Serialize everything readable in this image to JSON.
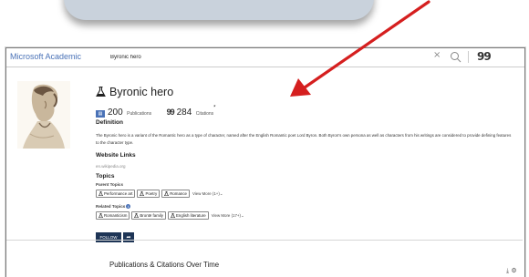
{
  "header": {
    "brand": "Microsoft Academic",
    "search_value": "Byronic hero",
    "clear_glyph": "×",
    "cite_glyph": "99"
  },
  "topic": {
    "title": "Byronic hero",
    "publications_count": "200",
    "publications_label": "Publications",
    "citations_count": "284",
    "citations_label": "Citations",
    "citations_marker": "*",
    "definition_heading": "Definition",
    "definition_text": "The Byronic hero is a variant of the Romantic hero as a type of character, named after the English Romantic poet Lord Byron. Both Byron's own persona as well as characters from his writings are considered to provide defining features to the character type.",
    "website_heading": "Website Links",
    "website_link": "en.wikipedia.org",
    "topics_heading": "Topics",
    "parent_topics_label": "Parent Topics",
    "parent_topics": [
      "Performance art",
      "Poetry",
      "Romance"
    ],
    "parent_view_more": "View More (1+)",
    "related_topics_label": "Related Topics",
    "related_topics": [
      "Romanticism",
      "Brontë family",
      "English literature"
    ],
    "related_view_more": "View More (17+)",
    "follow_label": "FOLLOW",
    "share_glyph": "➦",
    "chart_title": "Publications & Citations Over Time"
  },
  "colors": {
    "brand": "#4a72b7",
    "button": "#1e3556",
    "arrow": "#d51f1f"
  }
}
